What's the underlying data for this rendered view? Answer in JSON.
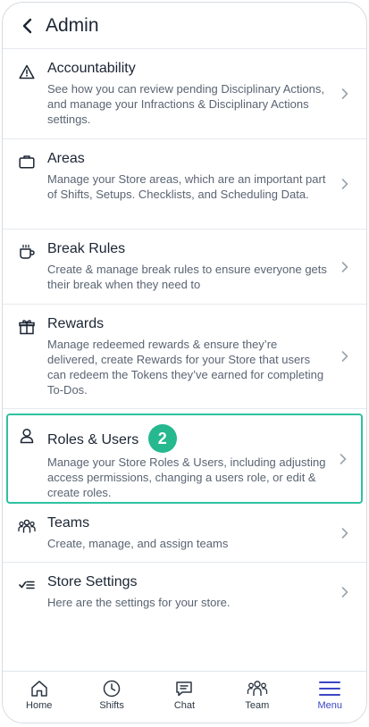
{
  "header": {
    "title": "Admin"
  },
  "items": [
    {
      "title": "Accountability",
      "desc": "See how you can review pending Disciplinary Actions, and manage your Infractions & Disciplinary Actions settings.",
      "icon": "warning-icon"
    },
    {
      "title": "Areas",
      "desc": "Manage your Store areas, which are an important part of Shifts, Setups. Checklists, and Scheduling Data.",
      "icon": "briefcase-icon"
    },
    {
      "title": "Break Rules",
      "desc": "Create & manage break rules to ensure everyone gets their break when they need to",
      "icon": "coffee-cup-icon"
    },
    {
      "title": "Rewards",
      "desc": "Manage redeemed rewards & ensure they’re delivered, create Rewards for your Store that users can redeem the Tokens they’ve earned for completing To-Dos.",
      "icon": "gift-icon"
    },
    {
      "title": "Roles & Users",
      "desc": "Manage your Store Roles & Users, including adjusting access permissions, changing a users role, or edit & create roles.",
      "icon": "user-icon",
      "badge": "2"
    },
    {
      "title": "Teams",
      "desc": "Create, manage, and assign teams",
      "icon": "team-icon"
    },
    {
      "title": "Store Settings",
      "desc": "Here are the settings for your store.",
      "icon": "checklist-icon"
    }
  ],
  "tabs": [
    {
      "label": "Home",
      "icon": "home-icon"
    },
    {
      "label": "Shifts",
      "icon": "clock-icon"
    },
    {
      "label": "Chat",
      "icon": "chat-icon"
    },
    {
      "label": "Team",
      "icon": "team-icon"
    },
    {
      "label": "Menu",
      "icon": "hamburger-menu-icon",
      "active": true
    }
  ],
  "colors": {
    "accent": "#3b46c4",
    "highlight_border": "#2fc1a1",
    "badge": "#26b88f"
  }
}
